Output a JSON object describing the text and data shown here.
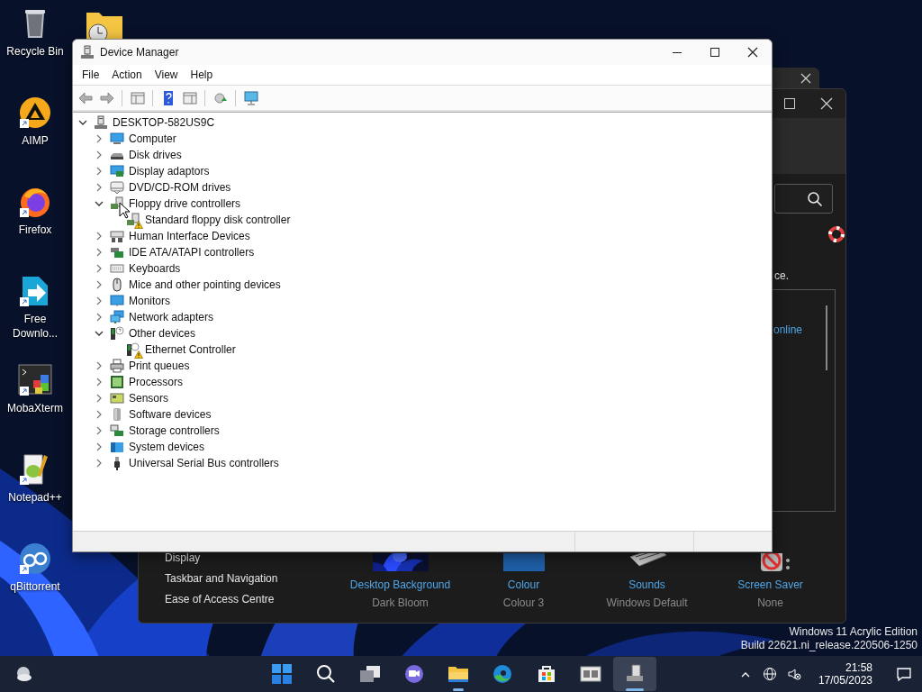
{
  "desktop_icons": [
    {
      "kind": "bin",
      "label": "Recycle Bin",
      "shortcut": false
    },
    {
      "kind": "aimp",
      "label": "AIMP",
      "shortcut": true
    },
    {
      "kind": "firefox",
      "label": "Firefox",
      "shortcut": true
    },
    {
      "kind": "download",
      "label": "Free Downlo...",
      "shortcut": true
    },
    {
      "kind": "terminal",
      "label": "MobaXterm",
      "shortcut": true
    },
    {
      "kind": "notepad",
      "label": "Notepad++",
      "shortcut": true
    },
    {
      "kind": "torrent",
      "label": "qBittorrent",
      "shortcut": true
    }
  ],
  "settings_window": {
    "intro_text": "ce.",
    "help_link": "online",
    "nav_links": [
      "Display",
      "Taskbar and Navigation",
      "Ease of Access Centre"
    ],
    "theme_items": [
      {
        "kind": "wallpaper",
        "title": "Desktop Background",
        "value": "Dark Bloom"
      },
      {
        "kind": "colour",
        "title": "Colour",
        "value": "Colour 3"
      },
      {
        "kind": "sounds",
        "title": "Sounds",
        "value": "Windows Default"
      },
      {
        "kind": "screensaver",
        "title": "Screen Saver",
        "value": "None"
      }
    ]
  },
  "device_manager": {
    "title": "Device Manager",
    "menu": [
      "File",
      "Action",
      "View",
      "Help"
    ],
    "tree": {
      "label": "DESKTOP-582US9C",
      "kind": "root",
      "expanded": true,
      "children": [
        {
          "label": "Computer",
          "kind": "computer",
          "expanded": false
        },
        {
          "label": "Disk drives",
          "kind": "disk",
          "expanded": false
        },
        {
          "label": "Display adaptors",
          "kind": "display",
          "expanded": false
        },
        {
          "label": "DVD/CD-ROM drives",
          "kind": "dvd",
          "expanded": false
        },
        {
          "label": "Floppy drive controllers",
          "kind": "floppy",
          "expanded": true,
          "children": [
            {
              "label": "Standard floppy disk controller",
              "kind": "floppy",
              "warning": true
            }
          ]
        },
        {
          "label": "Human Interface Devices",
          "kind": "hid",
          "expanded": false
        },
        {
          "label": "IDE ATA/ATAPI controllers",
          "kind": "ide",
          "expanded": false
        },
        {
          "label": "Keyboards",
          "kind": "keyboard",
          "expanded": false
        },
        {
          "label": "Mice and other pointing devices",
          "kind": "mouse",
          "expanded": false
        },
        {
          "label": "Monitors",
          "kind": "monitor",
          "expanded": false
        },
        {
          "label": "Network adapters",
          "kind": "network",
          "expanded": false
        },
        {
          "label": "Other devices",
          "kind": "other",
          "expanded": true,
          "children": [
            {
              "label": "Ethernet Controller",
              "kind": "unknown",
              "warning": true
            }
          ]
        },
        {
          "label": "Print queues",
          "kind": "print",
          "expanded": false
        },
        {
          "label": "Processors",
          "kind": "processor",
          "expanded": false
        },
        {
          "label": "Sensors",
          "kind": "sensor",
          "expanded": false
        },
        {
          "label": "Software devices",
          "kind": "software",
          "expanded": false
        },
        {
          "label": "Storage controllers",
          "kind": "storage",
          "expanded": false
        },
        {
          "label": "System devices",
          "kind": "system",
          "expanded": false
        },
        {
          "label": "Universal Serial Bus controllers",
          "kind": "usb",
          "expanded": false
        }
      ]
    }
  },
  "edition_text": [
    "Windows 11 Acrylic Edition",
    "Build 22621.ni_release.220506-1250"
  ],
  "taskbar": {
    "apps": [
      {
        "kind": "start",
        "running": false,
        "selected": false
      },
      {
        "kind": "search",
        "running": false,
        "selected": false
      },
      {
        "kind": "taskview",
        "running": false,
        "selected": false
      },
      {
        "kind": "chat",
        "running": false,
        "selected": false
      },
      {
        "kind": "explorer",
        "running": true,
        "selected": false
      },
      {
        "kind": "edge",
        "running": false,
        "selected": false
      },
      {
        "kind": "store",
        "running": false,
        "selected": false
      },
      {
        "kind": "panel",
        "running": false,
        "selected": false
      },
      {
        "kind": "devmgr",
        "running": true,
        "selected": true
      }
    ],
    "time": "21:58",
    "date": "17/05/2023"
  }
}
